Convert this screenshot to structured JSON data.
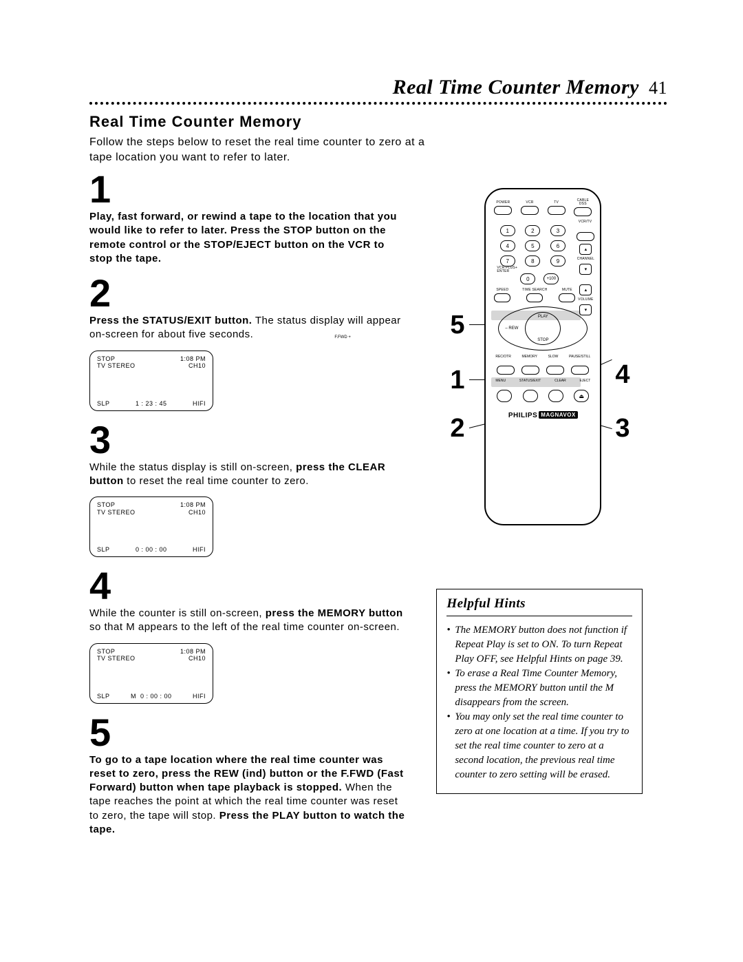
{
  "page": {
    "header_title": "Real Time Counter Memory",
    "header_pagenum": "41",
    "section_title": "Real Time Counter Memory",
    "intro": "Follow the steps below to reset the real time counter to zero at a tape location you want to refer to later."
  },
  "steps": {
    "s1_num": "1",
    "s1_text": "Play, fast forward, or rewind a tape to the location that you would like to refer to later. Press the STOP button on the remote control or the STOP/EJECT button on the VCR to stop the tape.",
    "s2_num": "2",
    "s2a": "Press the STATUS/EXIT button.",
    "s2b": " The status display will appear on-screen for about five seconds.",
    "s3_num": "3",
    "s3a": "While the status display is still on-screen, ",
    "s3b": "press the CLEAR button",
    "s3c": " to reset the real time counter to zero.",
    "s4_num": "4",
    "s4a": "While the counter is still on-screen, ",
    "s4b": "press the MEMORY button",
    "s4c": " so that M appears to the left of the real time counter on-screen.",
    "s5_num": "5",
    "s5a": "To go to a tape location where the real time counter was reset to zero, press the REW (ind) button or the F.FWD (Fast Forward) button when tape playback is stopped.",
    "s5b": " When the tape reaches the point at which the real time counter was reset to zero, the tape will stop. ",
    "s5c": "Press the PLAY button to watch the tape."
  },
  "display_common": {
    "stop": "STOP",
    "time": "1:08 PM",
    "stereo": "TV STEREO",
    "ch": "CH10",
    "slp": "SLP",
    "hifi": "HIFI"
  },
  "display1": {
    "counter": "1 : 23 : 45",
    "m": ""
  },
  "display2": {
    "counter": "0 : 00 : 00",
    "m": ""
  },
  "display3": {
    "counter": "0 : 00 : 00",
    "m": "M"
  },
  "remote_callouts": {
    "left_top": "5",
    "left_mid": "1",
    "left_bot": "2",
    "right_mid": "4",
    "right_bot": "3"
  },
  "remote": {
    "row1": {
      "a": "POWER",
      "b": "VCR",
      "c": "TV",
      "d": "CABLE\nDSS"
    },
    "vcr_tv": "VCR/TV",
    "num": {
      "n1": "1",
      "n2": "2",
      "n3": "3",
      "n4": "4",
      "n5": "5",
      "n6": "6",
      "n7": "7",
      "n8": "8",
      "n9": "9",
      "n0": "0",
      "p100": "+100"
    },
    "vcr_plus": "VCR PLUS+\nENTER",
    "channel": "CHANNEL",
    "row_mid": {
      "a": "SPEED",
      "b": "TIME SEARCH",
      "c": "MUTE",
      "d": "VOLUME"
    },
    "dpad": {
      "play": "PLAY",
      "stop": "STOP",
      "rew": "REW",
      "ffwd": "F.FWD",
      "minus": "–",
      "plus": "+"
    },
    "row_bot1": {
      "a": "REC/OTR",
      "b": "MEMORY",
      "c": "SLOW",
      "d": "PAUSE/STILL"
    },
    "row_bot2": {
      "a": "MENU",
      "b": "STATUS/EXIT",
      "c": "CLEAR",
      "d": "EJECT"
    },
    "brand": "PHILIPS",
    "brand2": "MAGNAVOX"
  },
  "hints": {
    "title": "Helpful Hints",
    "h1": "The MEMORY button does not function if Repeat Play is set to ON. To turn Repeat Play OFF, see Helpful Hints on page 39.",
    "h2": "To erase a Real Time Counter Memory, press the MEMORY button until the M disappears from the screen.",
    "h3": "You may only set the real time counter to zero at one location at a time. If you try to set the real time counter to zero at a second location, the previous real time counter to zero setting will be erased."
  }
}
